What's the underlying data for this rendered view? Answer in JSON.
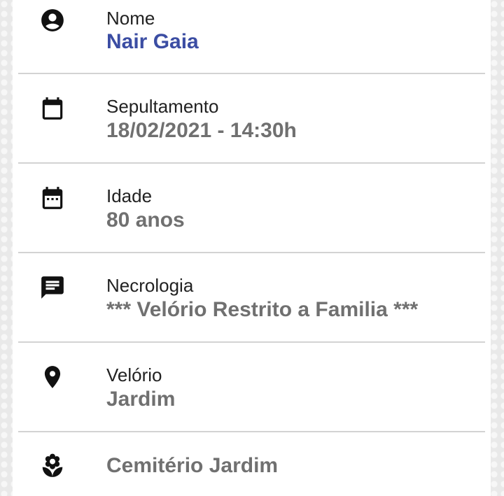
{
  "details": {
    "nome": {
      "label": "Nome",
      "value": "Nair Gaia",
      "icon": "account-circle-icon"
    },
    "sepultamento": {
      "label": "Sepultamento",
      "value": "18/02/2021 - 14:30h",
      "icon": "calendar-icon"
    },
    "idade": {
      "label": "Idade",
      "value": "80 anos",
      "icon": "calendar-today-icon"
    },
    "necrologia": {
      "label": "Necrologia",
      "value": "*** Velório Restrito a Familia ***",
      "icon": "message-icon"
    },
    "velorio": {
      "label": "Velório",
      "value": "Jardim",
      "icon": "location-pin-icon"
    },
    "cemiterio": {
      "value": "Cemitério Jardim",
      "icon": "flower-icon"
    }
  },
  "colors": {
    "accent": "#3b4da3",
    "value_gray": "#707070",
    "divider": "#d3d3d3"
  }
}
